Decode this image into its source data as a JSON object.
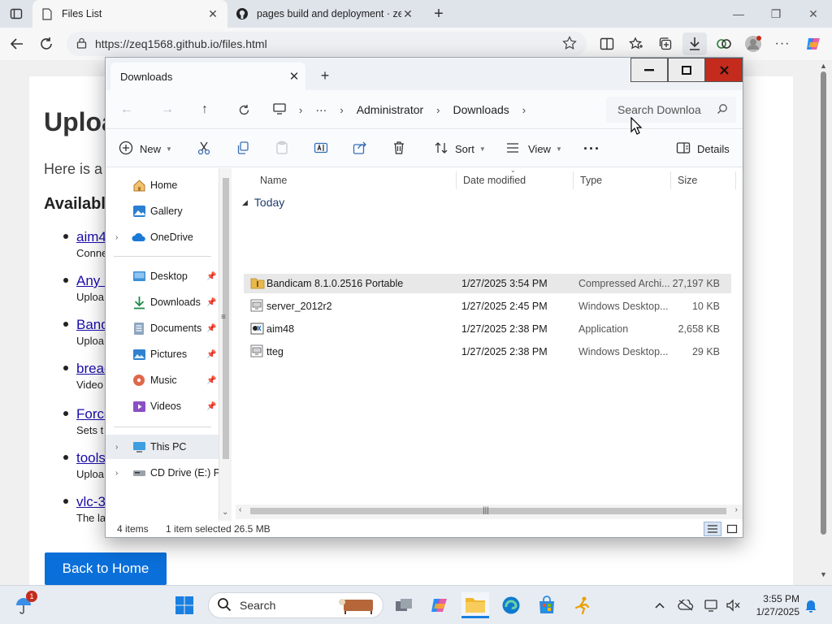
{
  "browser": {
    "tabs": [
      {
        "title": "Files List"
      },
      {
        "title": "pages build and deployment · zeq"
      }
    ],
    "url": "https://zeq1568.github.io/files.html"
  },
  "webpage": {
    "heading": "Uploa",
    "intro": "Here is a",
    "section": "Available",
    "items": [
      {
        "link": "aim4",
        "desc": "Conne"
      },
      {
        "link": "Any I",
        "desc": "Uploa"
      },
      {
        "link": "Band",
        "desc": "Uploa"
      },
      {
        "link": "breac",
        "desc": "Video"
      },
      {
        "link": "Force",
        "desc": "Sets t"
      },
      {
        "link": "tools",
        "desc": "Uploa"
      },
      {
        "link": "vlc-3",
        "desc": "The la"
      }
    ],
    "back_button": "Back to Home"
  },
  "explorer": {
    "tab_title": "Downloads",
    "breadcrumb": [
      "Administrator",
      "Downloads"
    ],
    "search_placeholder": "Search Downloa",
    "commands": {
      "new": "New",
      "sort": "Sort",
      "view": "View",
      "details": "Details"
    },
    "nav_pane": {
      "top": [
        {
          "label": "Home",
          "icon": "home-icon"
        },
        {
          "label": "Gallery",
          "icon": "gallery-icon"
        },
        {
          "label": "OneDrive",
          "icon": "cloud-icon"
        }
      ],
      "quick_access": [
        {
          "label": "Desktop",
          "icon": "desktop-icon"
        },
        {
          "label": "Downloads",
          "icon": "download-icon"
        },
        {
          "label": "Documents",
          "icon": "documents-icon"
        },
        {
          "label": "Pictures",
          "icon": "pictures-icon"
        },
        {
          "label": "Music",
          "icon": "music-icon"
        },
        {
          "label": "Videos",
          "icon": "videos-icon"
        }
      ],
      "devices": [
        {
          "label": "This PC",
          "icon": "pc-icon"
        },
        {
          "label": "CD Drive (E:) PV",
          "icon": "cd-drive-icon"
        }
      ]
    },
    "columns": {
      "name": "Name",
      "date": "Date modified",
      "type": "Type",
      "size": "Size"
    },
    "group": "Today",
    "files": [
      {
        "name": "Bandicam 8.1.0.2516 Portable",
        "date": "1/27/2025 3:54 PM",
        "type": "Compressed Archi...",
        "size": "27,197 KB",
        "icon": "zip-folder-icon"
      },
      {
        "name": "server_2012r2",
        "date": "1/27/2025 2:45 PM",
        "type": "Windows Desktop...",
        "size": "10 KB",
        "icon": "rdp-file-icon"
      },
      {
        "name": "aim48",
        "date": "1/27/2025 2:38 PM",
        "type": "Application",
        "size": "2,658 KB",
        "icon": "application-icon"
      },
      {
        "name": "tteg",
        "date": "1/27/2025 2:38 PM",
        "type": "Windows Desktop...",
        "size": "29 KB",
        "icon": "rdp-file-icon"
      }
    ],
    "status": {
      "count": "4 items",
      "selected": "1 item selected",
      "size": "26.5 MB"
    }
  },
  "taskbar": {
    "search_label": "Search",
    "notification_count": "1",
    "time": "3:55 PM",
    "date": "1/27/2025"
  },
  "colors": {
    "accent": "#0a6fd9",
    "close_red": "#c42b1c",
    "link": "#1a0dab"
  }
}
